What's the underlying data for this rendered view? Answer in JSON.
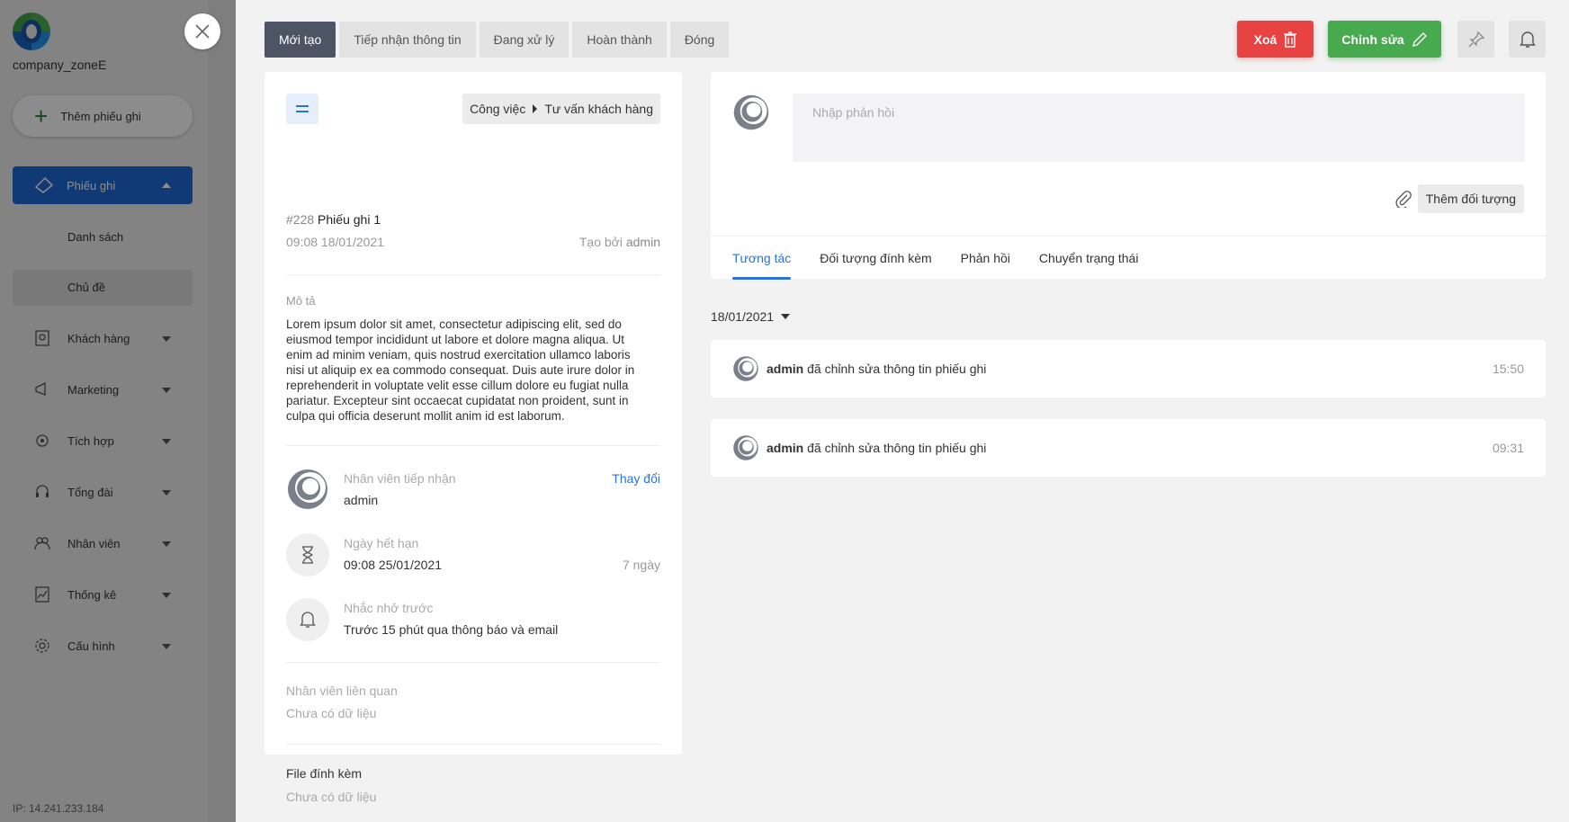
{
  "sidebar": {
    "company": "company_zoneE",
    "add_button": "Thêm phiếu ghi",
    "items": [
      {
        "label": "Phiếu ghi"
      },
      {
        "label": "Danh sách"
      },
      {
        "label": "Chủ đề"
      },
      {
        "label": "Khách hàng"
      },
      {
        "label": "Marketing"
      },
      {
        "label": "Tích hợp"
      },
      {
        "label": "Tổng đài"
      },
      {
        "label": "Nhân viên"
      },
      {
        "label": "Thống kê"
      },
      {
        "label": "Cấu hình"
      }
    ],
    "ip": "IP: 14.241.233.184"
  },
  "status_tabs": [
    "Mới tạo",
    "Tiếp nhận thông tin",
    "Đang xử lý",
    "Hoàn thành",
    "Đóng"
  ],
  "actions": {
    "delete": "Xoá",
    "edit": "Chỉnh sửa"
  },
  "ticket": {
    "breadcrumb": [
      "Công việc",
      "Tư vấn khách hàng"
    ],
    "number": "#228",
    "title": "Phiếu ghi 1",
    "created_time": "09:08 18/01/2021",
    "created_by_label": "Tạo bởi",
    "created_by": "admin",
    "description_label": "Mô tả",
    "description": "Lorem ipsum dolor sit amet, consectetur adipiscing elit, sed do eiusmod tempor incididunt ut labore et dolore magna aliqua. Ut enim ad minim veniam, quis nostrud exercitation ullamco laboris nisi ut aliquip ex ea commodo consequat. Duis aute irure dolor in reprehenderit in voluptate velit esse cillum dolore eu fugiat nulla pariatur. Excepteur sint occaecat cupidatat non proident, sunt in culpa qui officia deserunt mollit anim id est laborum.",
    "assignee_label": "Nhân viên tiếp nhận",
    "assignee": "admin",
    "change_label": "Thay đổi",
    "due_label": "Ngày hết hạn",
    "due": "09:08 25/01/2021",
    "due_remaining": "7 ngày",
    "reminder_label": "Nhắc nhở trước",
    "reminder": "Trước 15 phút qua thông báo và email",
    "related_label": "Nhân viên liên quan",
    "related_empty": "Chưa có dữ liệu",
    "files_label": "File đính kèm",
    "files_empty": "Chưa có dữ liệu"
  },
  "reply": {
    "placeholder": "Nhập phản hồi",
    "add_object": "Thêm đối tượng",
    "tabs": [
      "Tương tác",
      "Đối tượng đính kèm",
      "Phản hồi",
      "Chuyển trạng thái"
    ]
  },
  "timeline": {
    "date": "18/01/2021",
    "events": [
      {
        "user": "admin",
        "text": "đã chỉnh sửa thông tin phiếu ghi",
        "time": "15:50"
      },
      {
        "user": "admin",
        "text": "đã chỉnh sửa thông tin phiếu ghi",
        "time": "09:31"
      }
    ]
  },
  "colors": {
    "accent": "#2a73dd",
    "delete": "#e84343",
    "edit": "#48aa4e",
    "active_tab": "#4d5565"
  }
}
